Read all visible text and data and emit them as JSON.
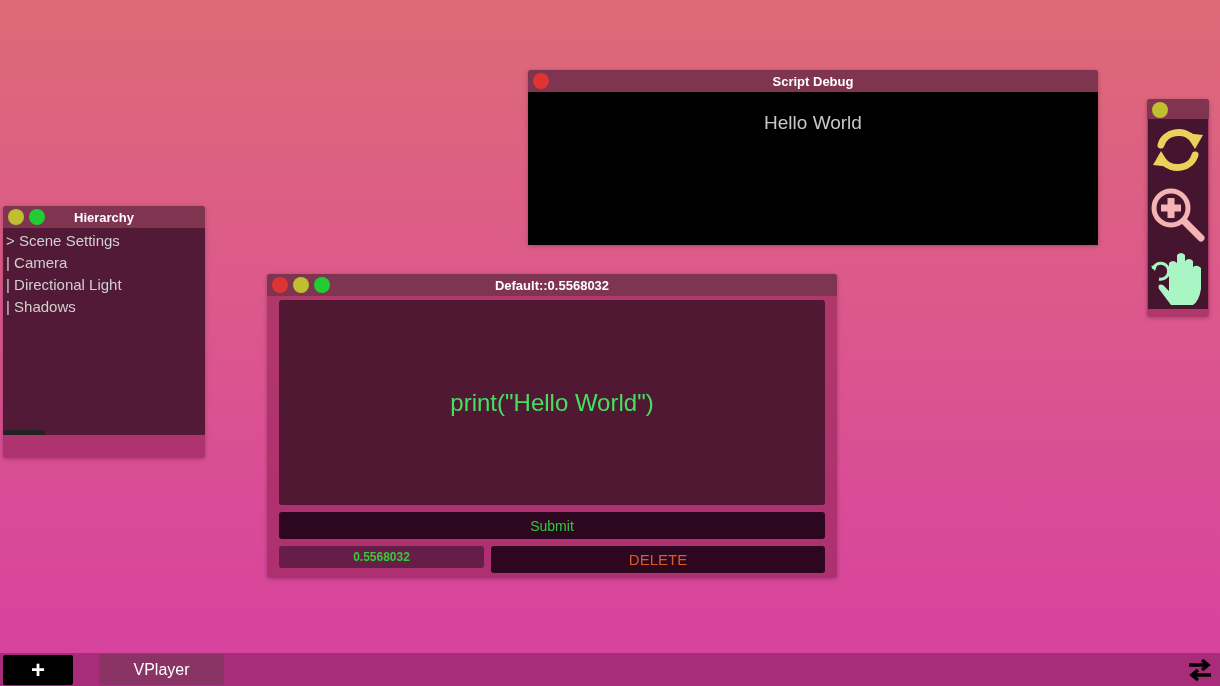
{
  "windows": [
    {
      "kind": "debug",
      "title": "Script Debug",
      "buttons": [
        {
          "kind": "close"
        }
      ],
      "output": "Hello World"
    },
    {
      "kind": "hierarchy",
      "title": "Hierarchy",
      "buttons": [
        {
          "kind": "minimize"
        },
        {
          "kind": "maximize"
        }
      ],
      "items": [
        "> Scene Settings",
        "| Camera",
        "| Directional Light",
        "| Shadows"
      ]
    },
    {
      "kind": "editor",
      "title": "Default::0.5568032",
      "buttons": [
        {
          "kind": "close"
        },
        {
          "kind": "minimize"
        },
        {
          "kind": "maximize"
        }
      ],
      "code": "print(\"Hello World\")",
      "submit": "Submit",
      "value": "0.5568032",
      "delete": "DELETE"
    },
    {
      "kind": "tools",
      "buttons": [
        {
          "kind": "minimize"
        }
      ],
      "tools": [
        {
          "kind": "refresh"
        },
        {
          "kind": "zoom-in"
        },
        {
          "kind": "pan"
        }
      ]
    }
  ],
  "taskbar": {
    "add": "+",
    "tabs": [
      {
        "label": "VPlayer"
      }
    ]
  }
}
